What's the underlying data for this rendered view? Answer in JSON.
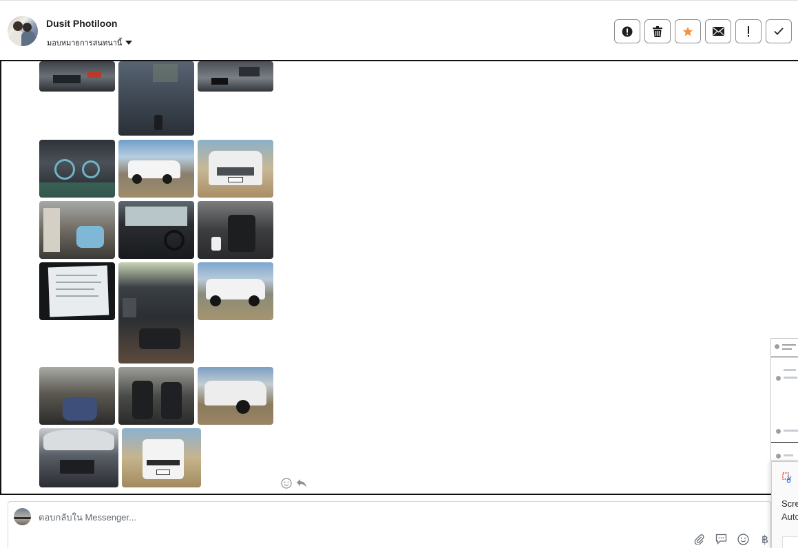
{
  "header": {
    "user_name": "Dusit Photiloon",
    "assign_label": "มอบหมายการสนทนานี้"
  },
  "actions": [
    {
      "name": "report-spam",
      "icon": "alert-circle-icon"
    },
    {
      "name": "delete",
      "icon": "trash-icon"
    },
    {
      "name": "star",
      "icon": "star-icon",
      "color": "#f5923e"
    },
    {
      "name": "mark-unread",
      "icon": "envelope-icon"
    },
    {
      "name": "follow-up",
      "icon": "exclamation-icon"
    },
    {
      "name": "mark-done",
      "icon": "checkmark-icon"
    }
  ],
  "composer": {
    "placeholder": "ตอบกลับใน Messenger..."
  },
  "overlay": {
    "snip_title": "Scre",
    "snip_subtitle": "Auto"
  },
  "colors": {
    "accent": "#f5923e",
    "border": "#8a8d91",
    "panel_border": "#111111",
    "muted_text": "#606770"
  }
}
